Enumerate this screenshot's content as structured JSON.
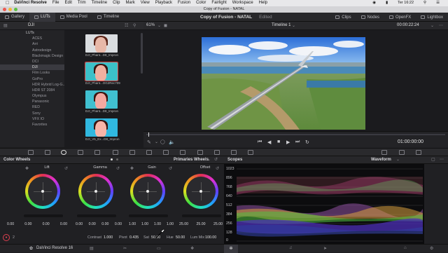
{
  "menubar": {
    "items": [
      "DaVinci Resolve",
      "File",
      "Edit",
      "Trim",
      "Timeline",
      "Clip",
      "Mark",
      "View",
      "Playback",
      "Fusion",
      "Color",
      "Fairlight",
      "Workspace",
      "Help"
    ],
    "clock": "Ter 16:22"
  },
  "window": {
    "title": "Copy of Fusion - NATAL"
  },
  "tabs": {
    "left": [
      "Gallery",
      "LUTs",
      "Media Pool",
      "Timeline"
    ],
    "project": "Copy of Fusion - NATAL",
    "status": "Edited",
    "right": [
      "Clips",
      "Nodes",
      "OpenFX",
      "Lightbox"
    ]
  },
  "lut_panel": {
    "folder": "DJI",
    "tree": [
      "LUTs",
      "ACES",
      "Arri",
      "Astrodesign",
      "Blackmagic Design",
      "DCI",
      "DJI",
      "Film Looks",
      "GoPro",
      "HDR Hybrid Log-G...",
      "HDR ST 2084",
      "Olympus",
      "Panasonic",
      "RED",
      "Sony",
      "VFX IO",
      "Favorites"
    ],
    "thumbs": [
      "DJI_Phant...D8_Impron",
      "DJI_Phant...OG2Rec709",
      "DJI_Phant...D8_Impron",
      "DJI_V5_Ex...D8_Impron"
    ]
  },
  "viewer": {
    "zoom": "61%",
    "timeline": "Timeline 1",
    "timecode": "00:00:22:24",
    "duration": "01:00:00:00"
  },
  "color_wheels": {
    "title": "Color Wheels",
    "mode": "Primaries Wheels",
    "wheels": [
      {
        "name": "Lift",
        "values": [
          "0.00",
          "0.00",
          "0.00",
          "0.00"
        ]
      },
      {
        "name": "Gamma",
        "values": [
          "0.00",
          "0.00",
          "0.00",
          "0.00"
        ]
      },
      {
        "name": "Gain",
        "values": [
          "1.00",
          "1.00",
          "1.00",
          "1.00"
        ]
      },
      {
        "name": "Offset",
        "values": [
          "25.00",
          "25.00",
          "25.00"
        ]
      }
    ],
    "bottom": {
      "page": "2",
      "contrast_label": "Contrast",
      "contrast": "1.000",
      "pivot_label": "Pivot",
      "pivot": "0.435",
      "sat_label": "Sat",
      "sat": "50.00",
      "hue_label": "Hue",
      "hue": "50.00",
      "lummix_label": "Lum Mix",
      "lummix": "100.00"
    }
  },
  "scopes": {
    "title": "Scopes",
    "mode": "Waveform",
    "scale": [
      "1023",
      "896",
      "768",
      "640",
      "512",
      "384",
      "256",
      "128",
      "0"
    ]
  },
  "dock": {
    "app": "DaVinci Resolve 16"
  },
  "colors": {
    "accent": "#d8334a",
    "panel": "#28282b",
    "bg": "#1e1e21"
  }
}
